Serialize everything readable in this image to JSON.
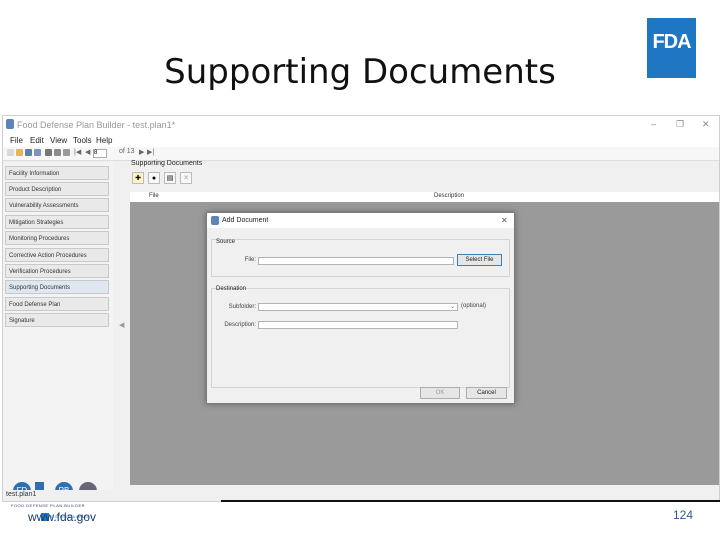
{
  "slide": {
    "title": "Supporting Documents",
    "logo_text": "FDA",
    "footer_url": "www.fda.gov",
    "page_number": "124"
  },
  "window": {
    "title": "Food Defense Plan Builder - test.plan1*",
    "controls": [
      "–",
      "❐",
      "✕"
    ],
    "menu": [
      "File",
      "Edit",
      "View",
      "Tools",
      "Help"
    ],
    "toolbar": {
      "page_value": "8",
      "page_of": "of 13"
    },
    "status": "test.plan1"
  },
  "nav": {
    "items": [
      "Facility Information",
      "Product Description",
      "Vulnerability Assessments",
      "Mitigation Strategies",
      "Monitoring Procedures",
      "Corrective Action Procedures",
      "Verification Procedures",
      "Supporting Documents",
      "Food Defense Plan",
      "Signature"
    ],
    "active": "Supporting Documents"
  },
  "logos": {
    "fd_pb_caption": "FOOD DEFENSE PLAN BUILDER",
    "agency_caption": "U.S. FOOD & DRUG"
  },
  "content": {
    "header": "Supporting Documents",
    "grid_columns": [
      "File",
      "Description"
    ]
  },
  "dialog": {
    "title": "Add Document",
    "close": "✕",
    "source_group": "Source",
    "file_label": "File:",
    "file_value": "",
    "select_file_button": "Select File",
    "destination_group": "Destination",
    "subfolder_label": "Subfolder:",
    "subfolder_value": "",
    "optional_note": "(optional)",
    "description_label": "Description:",
    "description_value": "",
    "ok_button": "OK",
    "cancel_button": "Cancel"
  },
  "colors": {
    "fda_blue": "#1f76c2",
    "grid_gray": "#9a9a9a"
  }
}
